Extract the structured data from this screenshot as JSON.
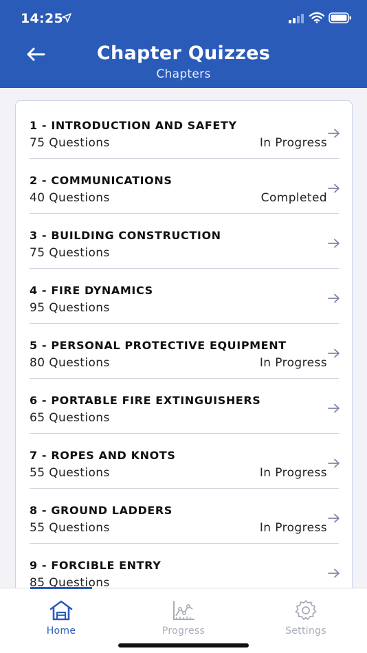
{
  "status_bar": {
    "time": "14:25"
  },
  "header": {
    "title": "Chapter Quizzes",
    "subtitle": "Chapters"
  },
  "chapters": [
    {
      "title": "1 - INTRODUCTION AND SAFETY",
      "questions": "75 Questions",
      "status": "In Progress"
    },
    {
      "title": "2 - COMMUNICATIONS",
      "questions": "40 Questions",
      "status": "Completed"
    },
    {
      "title": "3 - BUILDING CONSTRUCTION",
      "questions": "75 Questions",
      "status": ""
    },
    {
      "title": "4 - FIRE DYNAMICS",
      "questions": "95 Questions",
      "status": ""
    },
    {
      "title": "5 - PERSONAL PROTECTIVE EQUIPMENT",
      "questions": "80 Questions",
      "status": "In Progress"
    },
    {
      "title": "6 - PORTABLE FIRE EXTINGUISHERS",
      "questions": "65 Questions",
      "status": ""
    },
    {
      "title": "7 - ROPES AND KNOTS",
      "questions": "55 Questions",
      "status": "In Progress"
    },
    {
      "title": "8 - GROUND LADDERS",
      "questions": "55 Questions",
      "status": "In Progress"
    },
    {
      "title": "9 - FORCIBLE ENTRY",
      "questions": "85 Questions",
      "status": ""
    }
  ],
  "tabbar": {
    "tabs": [
      {
        "label": "Home",
        "icon": "home-icon",
        "active": true
      },
      {
        "label": "Progress",
        "icon": "progress-chart-icon",
        "active": false
      },
      {
        "label": "Settings",
        "icon": "gear-icon",
        "active": false
      }
    ]
  },
  "colors": {
    "brand": "#2a5bb8",
    "arrow": "#7d86a8",
    "inactive_tab": "#a7acb8"
  }
}
